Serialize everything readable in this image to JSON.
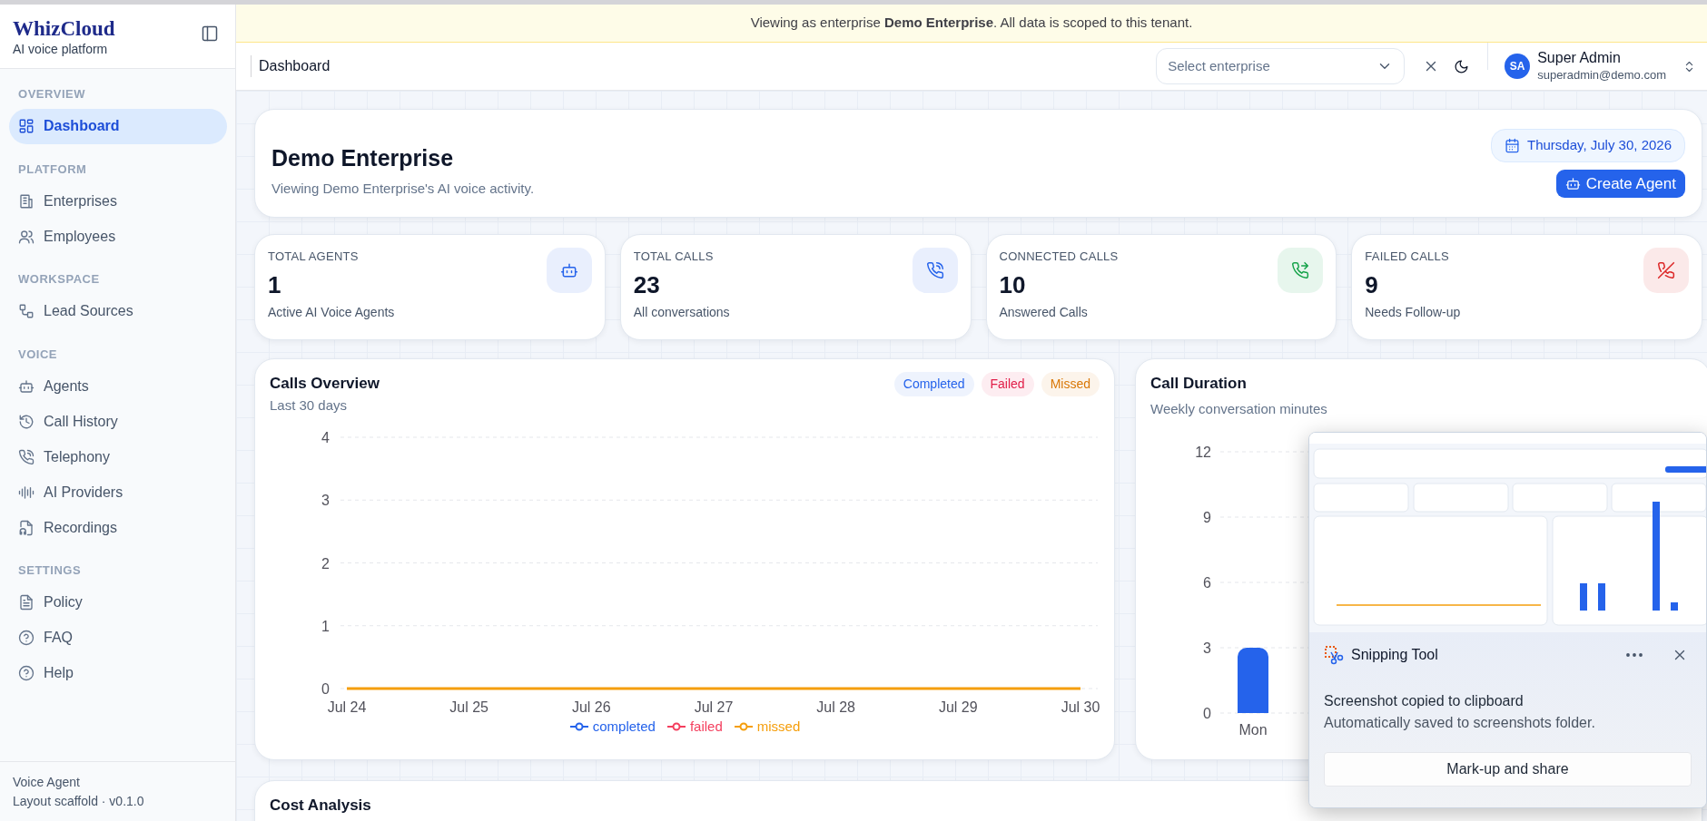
{
  "banner": {
    "text": "Viewing as enterprise **Demo Enterprise**. All data is scoped to this tenant."
  },
  "sidebar": {
    "brand": "WhizCloud",
    "tagline": "AI voice platform",
    "sections": [
      {
        "title": "OVERVIEW",
        "items": [
          {
            "label": "Dashboard",
            "selected": true
          }
        ]
      },
      {
        "title": "PLATFORM",
        "items": [
          {
            "label": "Enterprises",
            "selected": false
          },
          {
            "label": "Employees",
            "selected": false
          }
        ]
      },
      {
        "title": "WORKSPACE",
        "items": [
          {
            "label": "Lead Sources",
            "selected": false
          }
        ]
      },
      {
        "title": "VOICE",
        "items": [
          {
            "label": "Agents",
            "selected": false
          },
          {
            "label": "Call History",
            "selected": false
          },
          {
            "label": "Telephony",
            "selected": false
          },
          {
            "label": "AI Providers",
            "selected": false
          },
          {
            "label": "Recordings",
            "selected": false
          }
        ]
      },
      {
        "title": "SETTINGS",
        "items": [
          {
            "label": "Policy",
            "selected": false
          },
          {
            "label": "FAQ",
            "selected": false
          },
          {
            "label": "Help",
            "selected": false
          }
        ]
      }
    ],
    "footer": [
      "Voice Agent",
      "Layout scaffold · v0.1.0"
    ]
  },
  "header": {
    "title": "Dashboard",
    "enterprise_select": {
      "placeholder": "Select enterprise"
    },
    "user": {
      "initials": "SA",
      "name": "Super Admin",
      "email": "superadmin@demo.com"
    }
  },
  "hero": {
    "title": "Demo Enterprise",
    "subtitle": "Viewing Demo Enterprise's AI voice activity.",
    "date": "Thursday, July 30, 2026",
    "create_button": "Create Agent"
  },
  "stats": [
    {
      "label": "TOTAL AGENTS",
      "value": "1",
      "caption": "Active AI Voice Agents",
      "color": "#2563eb"
    },
    {
      "label": "TOTAL CALLS",
      "value": "23",
      "caption": "All conversations",
      "color": "#2563eb"
    },
    {
      "label": "CONNECTED CALLS",
      "value": "10",
      "caption": "Answered Calls",
      "color": "#16a34a"
    },
    {
      "label": "FAILED CALLS",
      "value": "9",
      "caption": "Needs Follow-up",
      "color": "#dc2626"
    }
  ],
  "calls_overview": {
    "title": "Calls Overview",
    "subtitle": "Last 30 days",
    "filters": [
      {
        "label": "Completed",
        "color": "#2563eb"
      },
      {
        "label": "Failed",
        "color": "#e11d48"
      },
      {
        "label": "Missed",
        "color": "#d97706"
      }
    ],
    "chart_data": {
      "type": "line",
      "categories": [
        "Jul 24",
        "Jul 25",
        "Jul 26",
        "Jul 27",
        "Jul 28",
        "Jul 29",
        "Jul 30"
      ],
      "ylim": [
        0,
        4
      ],
      "yticks": [
        0,
        1,
        2,
        3,
        4
      ],
      "grid": true,
      "series": [
        {
          "name": "completed",
          "color": "#2563eb",
          "values": [
            null,
            null,
            null,
            null,
            null,
            null,
            null
          ]
        },
        {
          "name": "failed",
          "color": "#f43f5e",
          "values": [
            null,
            null,
            null,
            null,
            null,
            null,
            null
          ]
        },
        {
          "name": "missed",
          "color": "#f59e0b",
          "values": [
            0,
            0,
            0,
            0,
            0,
            0,
            0
          ]
        }
      ]
    }
  },
  "call_duration": {
    "title": "Call Duration",
    "subtitle": "Weekly conversation minutes",
    "chart_data": {
      "type": "bar",
      "categories": [
        "Mon"
      ],
      "values": [
        3
      ],
      "ylim": [
        0,
        12
      ],
      "yticks": [
        0,
        3,
        6,
        9,
        12
      ],
      "grid": true
    }
  },
  "cost_analysis": {
    "title": "Cost Analysis"
  },
  "notification": {
    "app": "Snipping Tool",
    "title": "Screenshot copied to clipboard",
    "message": "Automatically saved to screenshots folder.",
    "button": "Mark-up and share"
  }
}
